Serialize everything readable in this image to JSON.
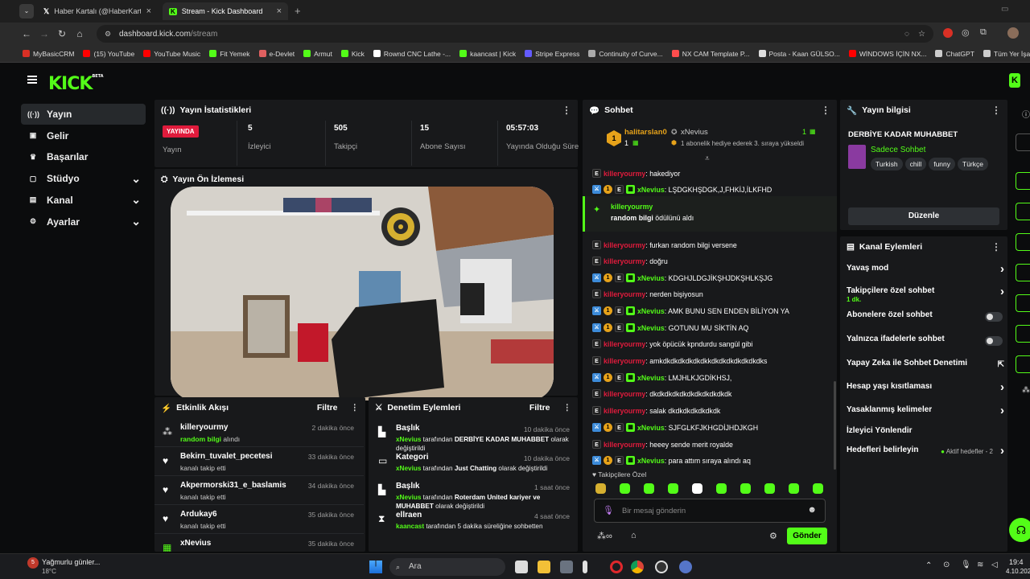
{
  "browser": {
    "tabs": [
      {
        "label": "Haber Kartalı (@HaberKartali) /",
        "icon": "x-icon"
      },
      {
        "label": "Stream - Kick Dashboard",
        "icon": "kick-icon"
      }
    ],
    "url_domain": "dashboard.kick.com",
    "url_path": "/stream",
    "bookmarks": [
      "MyBasicCRM",
      "(15) YouTube",
      "YouTube Music",
      "Fit Yemek",
      "e-Devlet",
      "Armut",
      "Kick",
      "Rownd CNC Lathe -...",
      "kaancast | Kick",
      "Stripe Express",
      "Continuity of Curve...",
      "NX CAM Template P...",
      "Posta - Kaan GÜLSO...",
      "WİNDOWS İÇİN NX...",
      "ChatGPT",
      "Tüm Yer İşareti"
    ],
    "bookmark_colors": [
      "#d93025",
      "#ff0000",
      "#ff0000",
      "#53fc18",
      "#e06060",
      "#53fc18",
      "#53fc18",
      "#ffffff",
      "#53fc18",
      "#635bff",
      "#aaaaaa",
      "#ff4d4d",
      "#dddddd",
      "#ff0000",
      "#cccccc",
      "#cccccc"
    ]
  },
  "brand": {
    "logo": "KICK",
    "beta": "BETA",
    "accent": "#53fc18"
  },
  "sidebar": {
    "items": [
      {
        "label": "Yayın",
        "icon": "broadcast-icon",
        "active": true
      },
      {
        "label": "Gelir",
        "icon": "revenue-icon"
      },
      {
        "label": "Başarılar",
        "icon": "trophy-icon"
      },
      {
        "label": "Stüdyo",
        "icon": "studio-icon",
        "expandable": true
      },
      {
        "label": "Kanal",
        "icon": "channel-icon",
        "expandable": true
      },
      {
        "label": "Ayarlar",
        "icon": "gear-icon",
        "expandable": true
      }
    ]
  },
  "stats": {
    "title": "Yayın İstatistikleri",
    "status": "YAYINDA",
    "status_label": "Yayın",
    "items": [
      {
        "value": "5",
        "label": "İzleyici"
      },
      {
        "value": "505",
        "label": "Takipçi"
      },
      {
        "value": "15",
        "label": "Abone Sayısı"
      },
      {
        "value": "05:57:03",
        "label": "Yayında Olduğu Süre"
      }
    ]
  },
  "preview": {
    "title": "Yayın Ön İzlemesi"
  },
  "activity": {
    "title": "Etkinlik Akışı",
    "filter": "Filtre",
    "items": [
      {
        "name": "killeryourmy",
        "sub": "random bilgi",
        "sub2": " alındı",
        "time": "2 dakika önce",
        "icon": "reward-icon"
      },
      {
        "name": "Bekirn_tuvalet_pecetesi",
        "sub": "kanalı takip etti",
        "time": "33 dakika önce",
        "icon": "heart-icon"
      },
      {
        "name": "Akpermorski31_e_baslamis",
        "sub": "kanalı takip etti",
        "time": "34 dakika önce",
        "icon": "heart-icon"
      },
      {
        "name": "Ardukay6",
        "sub": "kanalı takip etti",
        "time": "35 dakika önce",
        "icon": "heart-icon"
      },
      {
        "name": "xNevius",
        "sub": "",
        "time": "35 dakika önce",
        "icon": "sub-icon"
      }
    ]
  },
  "moderation": {
    "title": "Denetim Eylemleri",
    "filter": "Filtre",
    "items": [
      {
        "name": "Başlık",
        "user": "xNevius",
        "text1": " tarafından ",
        "value": "DERBİYE KADAR MUHABBET",
        "text2": " olarak değiştirildi",
        "time": "10 dakika önce",
        "icon": "title-icon"
      },
      {
        "name": "Kategori",
        "user": "xNevius",
        "text1": " tarafından ",
        "value": "Just Chatting",
        "text2": " olarak değiştirildi",
        "time": "10 dakika önce",
        "icon": "category-icon"
      },
      {
        "name": "Başlık",
        "user": "xNevius",
        "text1": " tarafından ",
        "value": "Roterdam United kariyer ve MUHABBET",
        "text2": " olarak değiştirildi",
        "time": "1 saat önce",
        "icon": "title-icon"
      },
      {
        "name": "ellraen",
        "user": "kaancast",
        "text1": " tarafından 5 dakika süreliğine sohbetten",
        "value": "",
        "text2": "",
        "time": "4 saat önce",
        "icon": "timeout-icon"
      }
    ]
  },
  "chat": {
    "title": "Sohbet",
    "pinned": {
      "user1": "halitarslan0",
      "user1_count": "1",
      "user2": "xNevius",
      "user2_count": "1",
      "text": "1 abonelik hediye ederek 3. sıraya yükseldi"
    },
    "messages": [
      {
        "user": "killeryourmy",
        "color": "red",
        "badges": [
          "e"
        ],
        "text": ": hakediyor"
      },
      {
        "user": "xNevius",
        "color": "green",
        "badges": [
          "k",
          "1",
          "e",
          "g"
        ],
        "text": ": LŞDGKHŞDGK,J,FHKİJ,İLKFHD"
      },
      {
        "user": "killeryourmy",
        "color": "red",
        "badges": [
          "e"
        ],
        "text": ": furkan random bilgi versene"
      },
      {
        "user": "killeryourmy",
        "color": "red",
        "badges": [
          "e"
        ],
        "text": ": doğru"
      },
      {
        "user": "xNevius",
        "color": "green",
        "badges": [
          "k",
          "1",
          "e",
          "g"
        ],
        "text": ": KDGHJLDGJİKŞHJDKŞHLKŞJG"
      },
      {
        "user": "killeryourmy",
        "color": "red",
        "badges": [
          "e"
        ],
        "text": ": nerden bişiyosun"
      },
      {
        "user": "xNevius",
        "color": "green",
        "badges": [
          "k",
          "1",
          "e",
          "g"
        ],
        "text": ": AMK BUNU SEN ENDEN BİLİYON YA"
      },
      {
        "user": "xNevius",
        "color": "green",
        "badges": [
          "k",
          "1",
          "e",
          "g"
        ],
        "text": ": GOTUNU MU SİKTİN AQ"
      },
      {
        "user": "killeryourmy",
        "color": "red",
        "badges": [
          "e"
        ],
        "text": ": yok öpücük kpndurdu sangül gibi"
      },
      {
        "user": "killeryourmy",
        "color": "red",
        "badges": [
          "e"
        ],
        "text": ": amkdkdkdkdkdkdkkdkdkdkdkdkdkdks"
      },
      {
        "user": "xNevius",
        "color": "green",
        "badges": [
          "k",
          "1",
          "e",
          "g"
        ],
        "text": ": LMJHLKJGDİKHSJ,"
      },
      {
        "user": "killeryourmy",
        "color": "red",
        "badges": [
          "e"
        ],
        "text": ": dkdkdkdkdkdkdkdkdkdkdk"
      },
      {
        "user": "killeryourmy",
        "color": "red",
        "badges": [
          "e"
        ],
        "text": ": salak dkdkdkdkdkdkdk"
      },
      {
        "user": "xNevius",
        "color": "green",
        "badges": [
          "k",
          "1",
          "e",
          "g"
        ],
        "text": ": SJFGLKFJKHGDİJHDJKGH"
      },
      {
        "user": "killeryourmy",
        "color": "red",
        "badges": [
          "e"
        ],
        "text": ": heeey sende merit royalde"
      },
      {
        "user": "xNevius",
        "color": "green",
        "badges": [
          "k",
          "1",
          "e",
          "g"
        ],
        "text": ": para attım sıraya alındı aq"
      }
    ],
    "reward": {
      "user": "killeryourmy",
      "reward": "random bilgi",
      "text": " ödülünü aldı"
    },
    "followers_only": "Takipçilere Özel",
    "input_placeholder": "Bir mesaj gönderin",
    "send": "Gönder"
  },
  "stream_info": {
    "title": "Yayın bilgisi",
    "stream_title": "DERBİYE KADAR MUHABBET",
    "category": "Sadece Sohbet",
    "tags": [
      "Turkish",
      "chill",
      "funny",
      "Türkçe"
    ],
    "edit": "Düzenle"
  },
  "channel_actions": {
    "title": "Kanal Eylemleri",
    "items": [
      {
        "label": "Yavaş mod",
        "type": "arrow"
      },
      {
        "label": "Takipçilere özel sohbet",
        "sub": "1 dk.",
        "type": "arrow"
      },
      {
        "label": "Abonelere özel sohbet",
        "type": "toggle"
      },
      {
        "label": "Yalnızca ifadelerle sohbet",
        "type": "toggle"
      },
      {
        "label": "Yapay Zeka ile Sohbet Denetimi",
        "type": "external"
      },
      {
        "label": "Hesap yaşı kısıtlaması",
        "type": "arrow"
      },
      {
        "label": "Yasaklanmış kelimeler",
        "type": "arrow"
      },
      {
        "label": "İzleyici Yönlendir",
        "type": "none"
      },
      {
        "label": "Hedefleri belirleyin",
        "extra": "Aktif hedefler - 2",
        "type": "arrow"
      }
    ]
  },
  "taskbar": {
    "weather": "Yağmurlu günler...",
    "temp": "18°C",
    "search": "Ara",
    "time": "19:4",
    "date": "4.10.202"
  }
}
